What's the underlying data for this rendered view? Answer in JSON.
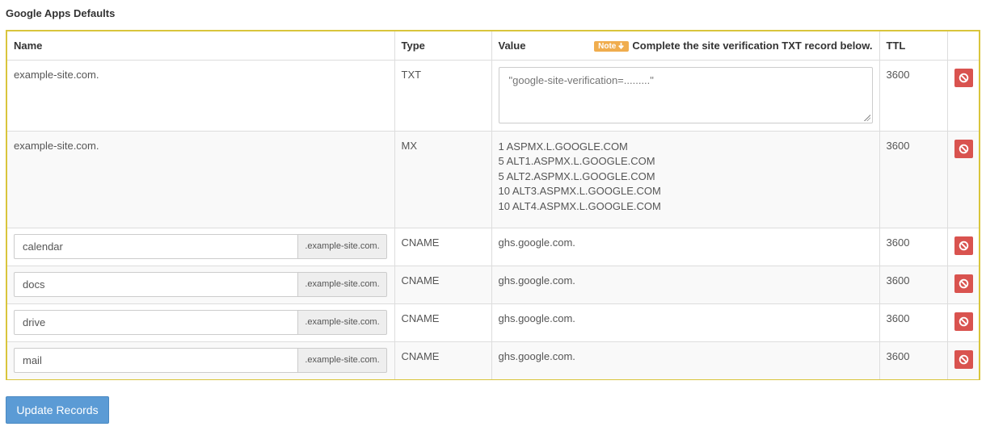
{
  "section": {
    "title": "Google Apps Defaults"
  },
  "table": {
    "headers": {
      "name": "Name",
      "type": "Type",
      "value": "Value",
      "ttl": "TTL"
    },
    "note": {
      "badge": "Note",
      "text": "Complete the site verification TXT record below."
    },
    "txt_row": {
      "name": "example-site.com.",
      "type": "TXT",
      "placeholder": "\"google-site-verification=.........\"",
      "ttl": "3600"
    },
    "mx_row": {
      "name": "example-site.com.",
      "type": "MX",
      "values": [
        "1 ASPMX.L.GOOGLE.COM",
        "5 ALT1.ASPMX.L.GOOGLE.COM",
        "5 ALT2.ASPMX.L.GOOGLE.COM",
        "10 ALT3.ASPMX.L.GOOGLE.COM",
        "10 ALT4.ASPMX.L.GOOGLE.COM"
      ],
      "ttl": "3600"
    },
    "cname_rows": [
      {
        "subdomain": "calendar",
        "suffix": ".example-site.com.",
        "type": "CNAME",
        "value": "ghs.google.com.",
        "ttl": "3600"
      },
      {
        "subdomain": "docs",
        "suffix": ".example-site.com.",
        "type": "CNAME",
        "value": "ghs.google.com.",
        "ttl": "3600"
      },
      {
        "subdomain": "drive",
        "suffix": ".example-site.com.",
        "type": "CNAME",
        "value": "ghs.google.com.",
        "ttl": "3600"
      },
      {
        "subdomain": "mail",
        "suffix": ".example-site.com.",
        "type": "CNAME",
        "value": "ghs.google.com.",
        "ttl": "3600"
      }
    ]
  },
  "actions": {
    "update_label": "Update Records"
  },
  "colors": {
    "highlight_border": "#d9c53c",
    "note_badge": "#f0ad4e",
    "delete_button": "#d9534f",
    "primary_button": "#5b9bd5"
  },
  "icons": {
    "delete": "ban-icon",
    "note_arrow": "arrow-down-icon"
  }
}
